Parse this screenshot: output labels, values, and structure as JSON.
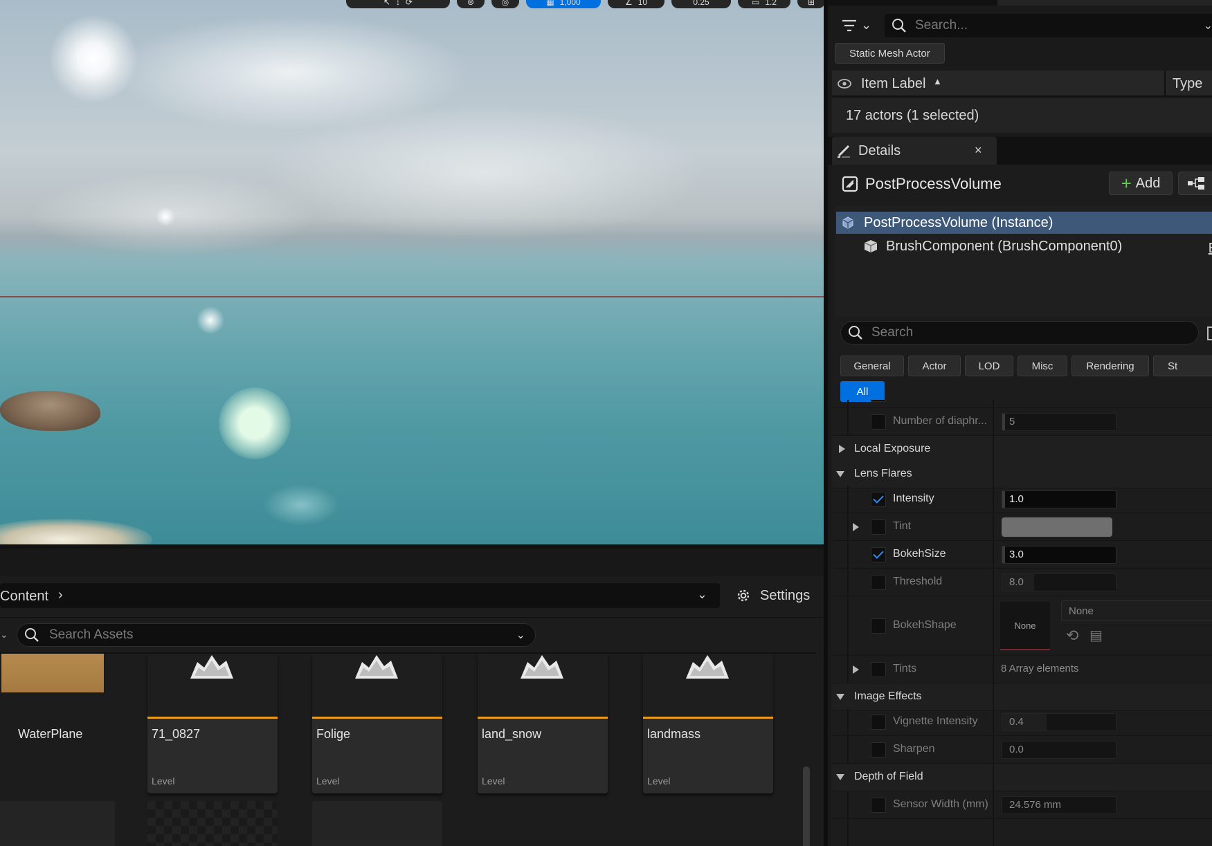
{
  "viewport": {
    "toolbar": [
      "",
      "",
      "",
      "",
      "",
      "",
      "1,000",
      "10",
      "0.25",
      "1.2",
      ""
    ]
  },
  "content_browser": {
    "path_label": "Content",
    "settings_label": "Settings",
    "search_placeholder": "Search Assets",
    "assets": [
      {
        "name": "WaterPlane",
        "type": ""
      },
      {
        "name": "71_0827",
        "type": "Level"
      },
      {
        "name": "Folige",
        "type": "Level"
      },
      {
        "name": "land_snow",
        "type": "Level"
      },
      {
        "name": "landmass",
        "type": "Level"
      }
    ]
  },
  "outliner": {
    "search_placeholder": "Search...",
    "filter_chip": "Static Mesh Actor",
    "col_label": "Item Label",
    "col_type": "Type",
    "actor_count": "17 actors (1 selected)"
  },
  "details": {
    "tab_label": "Details",
    "close_glyph": "×",
    "actor_name": "PostProcessVolume",
    "add_label": "Add",
    "components": {
      "instance": "PostProcessVolume (Instance)",
      "brush": "BrushComponent (BrushComponent0)",
      "edit_link": "E"
    },
    "search_placeholder": "Search",
    "categories": [
      "General",
      "Actor",
      "LOD",
      "Misc",
      "Rendering",
      "St",
      "All"
    ],
    "properties": {
      "diaphragm_label": "Number of diaphr...",
      "diaphragm_value": "5",
      "local_exposure": "Local Exposure",
      "lens_flares": "Lens Flares",
      "intensity_label": "Intensity",
      "intensity_value": "1.0",
      "tint_label": "Tint",
      "bokeh_size_label": "BokehSize",
      "bokeh_size_value": "3.0",
      "threshold_label": "Threshold",
      "threshold_value": "8.0",
      "bokeh_shape_label": "BokehShape",
      "bokeh_shape_thumb": "None",
      "bokeh_shape_value": "None",
      "tints_label": "Tints",
      "tints_value": "8 Array elements",
      "image_effects": "Image Effects",
      "vignette_label": "Vignette Intensity",
      "vignette_value": "0.4",
      "sharpen_label": "Sharpen",
      "sharpen_value": "0.0",
      "dof": "Depth of Field",
      "sensor_label": "Sensor Width (mm)",
      "sensor_value": "24.576 mm"
    }
  },
  "colors": {
    "accent_blue": "#0070e0",
    "selection_row": "#3d5878",
    "level_underline": "#e89a1e",
    "add_plus": "#5dd04a"
  }
}
